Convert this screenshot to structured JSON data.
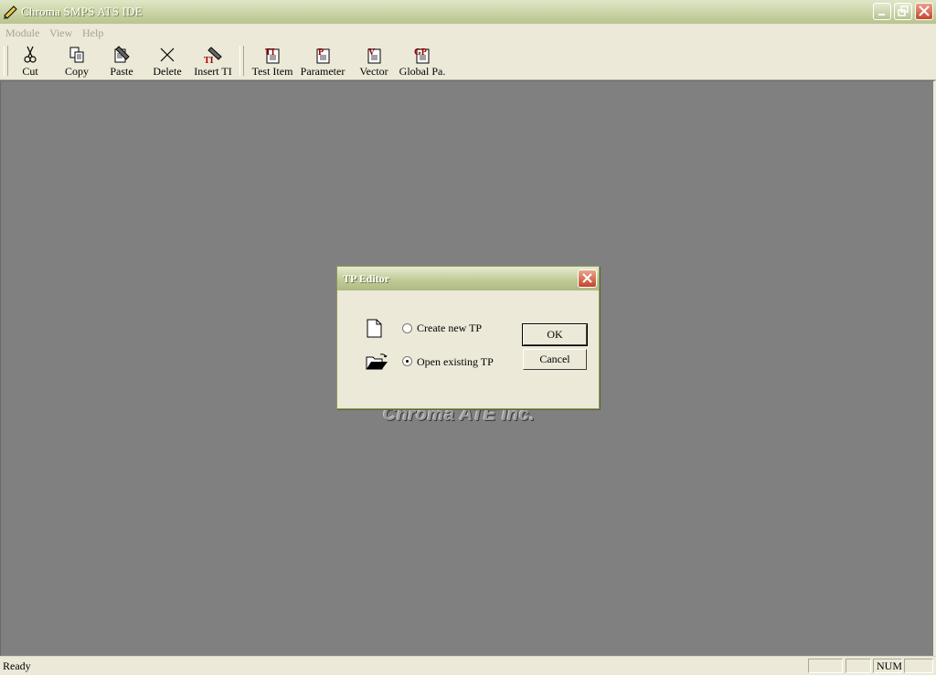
{
  "window": {
    "title": "Chroma SMPS ATS IDE"
  },
  "menu": {
    "items": [
      "Module",
      "View",
      "Help"
    ]
  },
  "toolbar": {
    "buttons": [
      {
        "label": "Cut",
        "icon": "scissors-icon"
      },
      {
        "label": "Copy",
        "icon": "copy-icon"
      },
      {
        "label": "Paste",
        "icon": "paste-icon"
      },
      {
        "label": "Delete",
        "icon": "delete-x-icon"
      },
      {
        "label": "Insert TI",
        "icon": "insert-ti-icon",
        "icon_text": "TI"
      },
      {
        "label": "Test Item",
        "icon": "test-item-icon",
        "icon_text": "TI"
      },
      {
        "label": "Parameter",
        "icon": "parameter-icon",
        "icon_text": "P"
      },
      {
        "label": "Vector",
        "icon": "vector-icon",
        "icon_text": "V"
      },
      {
        "label": "Global Pa.",
        "icon": "global-param-icon",
        "icon_text": "GP"
      }
    ]
  },
  "workspace": {
    "watermark": "Chroma ATE Inc.",
    "background": "#808080"
  },
  "dialog": {
    "title": "TP Editor",
    "options": [
      {
        "label": "Create new TP",
        "selected": false,
        "icon": "new-document-icon"
      },
      {
        "label": "Open existing TP",
        "selected": true,
        "icon": "open-folder-icon"
      }
    ],
    "ok_label": "OK",
    "cancel_label": "Cancel"
  },
  "statusbar": {
    "text": "Ready",
    "panes": [
      "",
      "",
      "NUM",
      ""
    ]
  },
  "colors": {
    "titlebar": "#c7d1a2",
    "face": "#ece9d8",
    "accent_red": "#a00000"
  }
}
